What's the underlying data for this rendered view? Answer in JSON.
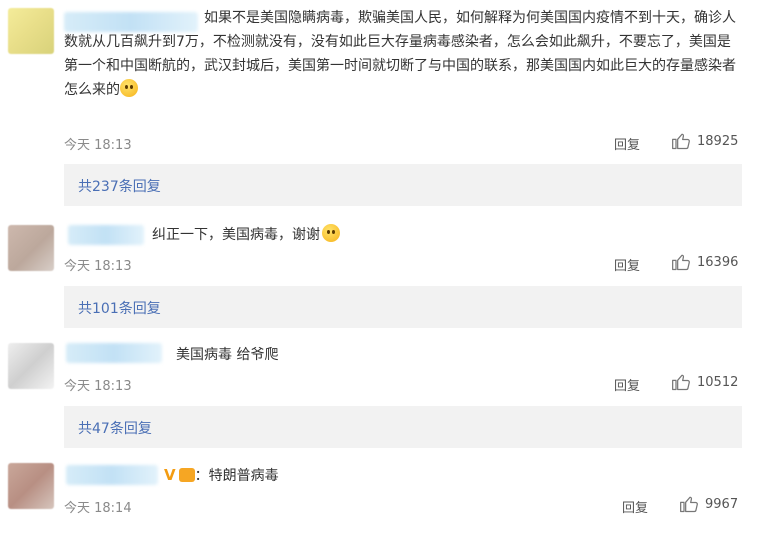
{
  "comments": [
    {
      "text": "如果不是美国隐瞒病毒，欺骗美国人民，如何解释为何美国国内疫情不到十天，确诊人数就从几百飙升到7万，不检测就没有，没有如此巨大存量病毒感染者，怎么会如此飙升，不要忘了，美国是第一个和中国断航的，武汉封城后，美国第一时间就切断了与中国的联系，那美国国内如此巨大的存量感染者怎么来的",
      "time": "今天 18:13",
      "reply": "回复",
      "likes": "18925",
      "sub_replies": "共237条回复"
    },
    {
      "text": "纠正一下，美国病毒，谢谢",
      "time": "今天 18:13",
      "reply": "回复",
      "likes": "16396",
      "sub_replies": "共101条回复"
    },
    {
      "text": "美国病毒 给爷爬",
      "time": "今天 18:13",
      "reply": "回复",
      "likes": "10512",
      "sub_replies": "共47条回复"
    },
    {
      "badge": "V",
      "text": "：特朗普病毒",
      "time": "今天 18:14",
      "reply": "回复",
      "likes": "9967"
    }
  ],
  "icons": {
    "like": "thumbs-up-icon",
    "emoji": "smiley-emoji-icon",
    "badge": "vip-badge-icon"
  },
  "colors": {
    "link": "#4a6fb5",
    "subbox_bg": "#f2f2f2",
    "time": "#8a8a8a",
    "badge": "#f39c12"
  }
}
